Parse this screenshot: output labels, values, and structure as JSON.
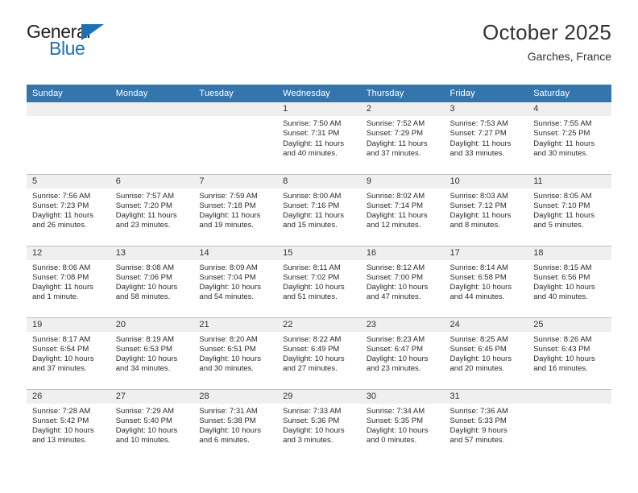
{
  "brand": {
    "name_top": "General",
    "name_bottom": "Blue",
    "accent_color": "#1f6fb5",
    "triangle_icon": "triangle-icon"
  },
  "header": {
    "month_title": "October 2025",
    "location": "Garches, France",
    "header_bg_color": "#3575ad",
    "daynum_bg_color": "#efefef"
  },
  "calendar": {
    "weekday_headers": [
      "Sunday",
      "Monday",
      "Tuesday",
      "Wednesday",
      "Thursday",
      "Friday",
      "Saturday"
    ],
    "labels": {
      "sunrise": "Sunrise:",
      "sunset": "Sunset:",
      "daylight": "Daylight:"
    },
    "weeks": [
      [
        {
          "day": "",
          "empty": true
        },
        {
          "day": "",
          "empty": true
        },
        {
          "day": "",
          "empty": true
        },
        {
          "day": "1",
          "sunrise": "Sunrise: 7:50 AM",
          "sunset": "Sunset: 7:31 PM",
          "daylight1": "Daylight: 11 hours",
          "daylight2": "and 40 minutes."
        },
        {
          "day": "2",
          "sunrise": "Sunrise: 7:52 AM",
          "sunset": "Sunset: 7:29 PM",
          "daylight1": "Daylight: 11 hours",
          "daylight2": "and 37 minutes."
        },
        {
          "day": "3",
          "sunrise": "Sunrise: 7:53 AM",
          "sunset": "Sunset: 7:27 PM",
          "daylight1": "Daylight: 11 hours",
          "daylight2": "and 33 minutes."
        },
        {
          "day": "4",
          "sunrise": "Sunrise: 7:55 AM",
          "sunset": "Sunset: 7:25 PM",
          "daylight1": "Daylight: 11 hours",
          "daylight2": "and 30 minutes."
        }
      ],
      [
        {
          "day": "5",
          "sunrise": "Sunrise: 7:56 AM",
          "sunset": "Sunset: 7:23 PM",
          "daylight1": "Daylight: 11 hours",
          "daylight2": "and 26 minutes."
        },
        {
          "day": "6",
          "sunrise": "Sunrise: 7:57 AM",
          "sunset": "Sunset: 7:20 PM",
          "daylight1": "Daylight: 11 hours",
          "daylight2": "and 23 minutes."
        },
        {
          "day": "7",
          "sunrise": "Sunrise: 7:59 AM",
          "sunset": "Sunset: 7:18 PM",
          "daylight1": "Daylight: 11 hours",
          "daylight2": "and 19 minutes."
        },
        {
          "day": "8",
          "sunrise": "Sunrise: 8:00 AM",
          "sunset": "Sunset: 7:16 PM",
          "daylight1": "Daylight: 11 hours",
          "daylight2": "and 15 minutes."
        },
        {
          "day": "9",
          "sunrise": "Sunrise: 8:02 AM",
          "sunset": "Sunset: 7:14 PM",
          "daylight1": "Daylight: 11 hours",
          "daylight2": "and 12 minutes."
        },
        {
          "day": "10",
          "sunrise": "Sunrise: 8:03 AM",
          "sunset": "Sunset: 7:12 PM",
          "daylight1": "Daylight: 11 hours",
          "daylight2": "and 8 minutes."
        },
        {
          "day": "11",
          "sunrise": "Sunrise: 8:05 AM",
          "sunset": "Sunset: 7:10 PM",
          "daylight1": "Daylight: 11 hours",
          "daylight2": "and 5 minutes."
        }
      ],
      [
        {
          "day": "12",
          "sunrise": "Sunrise: 8:06 AM",
          "sunset": "Sunset: 7:08 PM",
          "daylight1": "Daylight: 11 hours",
          "daylight2": "and 1 minute."
        },
        {
          "day": "13",
          "sunrise": "Sunrise: 8:08 AM",
          "sunset": "Sunset: 7:06 PM",
          "daylight1": "Daylight: 10 hours",
          "daylight2": "and 58 minutes."
        },
        {
          "day": "14",
          "sunrise": "Sunrise: 8:09 AM",
          "sunset": "Sunset: 7:04 PM",
          "daylight1": "Daylight: 10 hours",
          "daylight2": "and 54 minutes."
        },
        {
          "day": "15",
          "sunrise": "Sunrise: 8:11 AM",
          "sunset": "Sunset: 7:02 PM",
          "daylight1": "Daylight: 10 hours",
          "daylight2": "and 51 minutes."
        },
        {
          "day": "16",
          "sunrise": "Sunrise: 8:12 AM",
          "sunset": "Sunset: 7:00 PM",
          "daylight1": "Daylight: 10 hours",
          "daylight2": "and 47 minutes."
        },
        {
          "day": "17",
          "sunrise": "Sunrise: 8:14 AM",
          "sunset": "Sunset: 6:58 PM",
          "daylight1": "Daylight: 10 hours",
          "daylight2": "and 44 minutes."
        },
        {
          "day": "18",
          "sunrise": "Sunrise: 8:15 AM",
          "sunset": "Sunset: 6:56 PM",
          "daylight1": "Daylight: 10 hours",
          "daylight2": "and 40 minutes."
        }
      ],
      [
        {
          "day": "19",
          "sunrise": "Sunrise: 8:17 AM",
          "sunset": "Sunset: 6:54 PM",
          "daylight1": "Daylight: 10 hours",
          "daylight2": "and 37 minutes."
        },
        {
          "day": "20",
          "sunrise": "Sunrise: 8:19 AM",
          "sunset": "Sunset: 6:53 PM",
          "daylight1": "Daylight: 10 hours",
          "daylight2": "and 34 minutes."
        },
        {
          "day": "21",
          "sunrise": "Sunrise: 8:20 AM",
          "sunset": "Sunset: 6:51 PM",
          "daylight1": "Daylight: 10 hours",
          "daylight2": "and 30 minutes."
        },
        {
          "day": "22",
          "sunrise": "Sunrise: 8:22 AM",
          "sunset": "Sunset: 6:49 PM",
          "daylight1": "Daylight: 10 hours",
          "daylight2": "and 27 minutes."
        },
        {
          "day": "23",
          "sunrise": "Sunrise: 8:23 AM",
          "sunset": "Sunset: 6:47 PM",
          "daylight1": "Daylight: 10 hours",
          "daylight2": "and 23 minutes."
        },
        {
          "day": "24",
          "sunrise": "Sunrise: 8:25 AM",
          "sunset": "Sunset: 6:45 PM",
          "daylight1": "Daylight: 10 hours",
          "daylight2": "and 20 minutes."
        },
        {
          "day": "25",
          "sunrise": "Sunrise: 8:26 AM",
          "sunset": "Sunset: 6:43 PM",
          "daylight1": "Daylight: 10 hours",
          "daylight2": "and 16 minutes."
        }
      ],
      [
        {
          "day": "26",
          "sunrise": "Sunrise: 7:28 AM",
          "sunset": "Sunset: 5:42 PM",
          "daylight1": "Daylight: 10 hours",
          "daylight2": "and 13 minutes."
        },
        {
          "day": "27",
          "sunrise": "Sunrise: 7:29 AM",
          "sunset": "Sunset: 5:40 PM",
          "daylight1": "Daylight: 10 hours",
          "daylight2": "and 10 minutes."
        },
        {
          "day": "28",
          "sunrise": "Sunrise: 7:31 AM",
          "sunset": "Sunset: 5:38 PM",
          "daylight1": "Daylight: 10 hours",
          "daylight2": "and 6 minutes."
        },
        {
          "day": "29",
          "sunrise": "Sunrise: 7:33 AM",
          "sunset": "Sunset: 5:36 PM",
          "daylight1": "Daylight: 10 hours",
          "daylight2": "and 3 minutes."
        },
        {
          "day": "30",
          "sunrise": "Sunrise: 7:34 AM",
          "sunset": "Sunset: 5:35 PM",
          "daylight1": "Daylight: 10 hours",
          "daylight2": "and 0 minutes."
        },
        {
          "day": "31",
          "sunrise": "Sunrise: 7:36 AM",
          "sunset": "Sunset: 5:33 PM",
          "daylight1": "Daylight: 9 hours",
          "daylight2": "and 57 minutes."
        },
        {
          "day": "",
          "empty": true
        }
      ]
    ]
  }
}
